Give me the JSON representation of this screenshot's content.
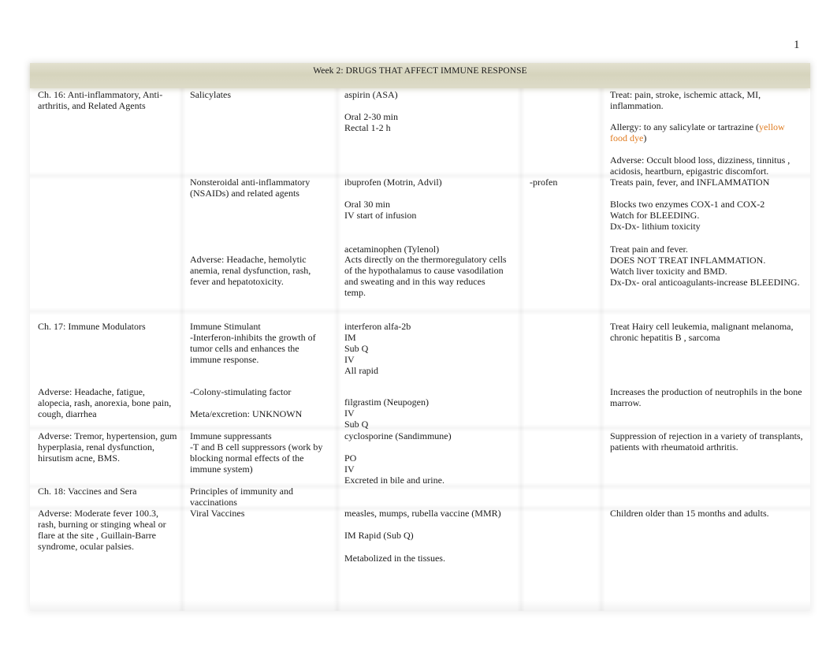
{
  "page_number": "1",
  "header": {
    "title": "Week 2:   DRUGS THAT AFFECT IMMUNE RESPONSE"
  },
  "rows": {
    "r1": {
      "chapter": "Ch. 16: Anti-inflammatory, Anti-\narthritis, and Related Agents",
      "class": "Salicylates",
      "drug_name": "aspirin (ASA)",
      "drug_routes": "Oral 2-30 min\nRectal 1-2 h",
      "stem": "",
      "uses": "Treat: pain, stroke, ischemic attack, MI,\ninflammation.",
      "allergy_prefix": "Allergy: to any salicylate or tartrazine (",
      "allergy_highlight": "yellow\nfood dye",
      "allergy_suffix": ")",
      "adverse": "Adverse: Occult blood loss, dizziness, tinnitus ,\nacidosis, heartburn, epigastric discomfort."
    },
    "r2": {
      "class": "Nonsteroidal anti-inflammatory\n(NSAIDs) and related agents",
      "class_adverse": "Adverse: Headache, hemolytic\nanemia, renal dysfunction, rash,\nfever and hepatotoxicity.",
      "drug_name": "ibuprofen (Motrin, Advil)",
      "drug_routes": "Oral 30 min\nIV start of infusion",
      "drug2_name": "acetaminophen (Tylenol)",
      "drug2_desc": "Acts directly on the thermoregulatory cells\nof the hypothalamus to cause vasodilation\nand sweating and in this way reduces\ntemp.",
      "stem": "-profen",
      "uses": "Treats pain, fever, and INFLAMMATION",
      "uses_detail": "Blocks two enzymes COX-1 and COX-2\nWatch for BLEEDING.\nDx-Dx- lithium toxicity",
      "uses2": "Treat pain and fever.\nDOES NOT TREAT INFLAMMATION.\nWatch liver toxicity and BMD.\nDx-Dx- oral anticoagulants-increase BLEEDING."
    },
    "r3": {
      "chapter": "Ch. 17: Immune Modulators",
      "chapter_adverse": "Adverse: Headache, fatigue,\nalopecia, rash, anorexia, bone pain,\ncough, diarrhea",
      "class": "Immune Stimulant\n-Interferon-inhibits the growth of\ntumor cells and enhances the\nimmune response.",
      "class2": "-Colony-stimulating factor",
      "class2_meta": "Meta/excretion: UNKNOWN",
      "drug_name": "interferon alfa-2b\nIM\nSub Q\nIV\nAll rapid",
      "drug2_name": "filgrastim (Neupogen)\nIV\nSub Q",
      "uses": "Treat Hairy cell leukemia, malignant melanoma,\nchronic hepatitis B  , sarcoma",
      "uses2": "Increases the production of neutrophils in the bone\nmarrow."
    },
    "r4": {
      "chapter_adverse": "Adverse: Tremor, hypertension, gum\nhyperplasia, renal dysfunction,\nhirsutism acne, BMS.",
      "class": "Immune suppressants\n-T and B cell suppressors (work by\nblocking normal effects of the\nimmune system)",
      "drug_name": "cyclosporine (Sandimmune)",
      "drug_routes": "PO\nIV\nExcreted in bile and urine.",
      "uses": "Suppression of rejection in a variety of transplants,\npatients with rheumatoid arthritis."
    },
    "r5": {
      "chapter": "Ch. 18: Vaccines and Sera",
      "class": "Principles of immunity and\nvaccinations"
    },
    "r6": {
      "chapter_adverse": "Adverse: Moderate fever 100.3,\nrash, burning or stinging wheal or\nflare at the site , Guillain-Barre\nsyndrome, ocular palsies.",
      "class": "Viral Vaccines",
      "drug_name": "measles, mumps, rubella vaccine (MMR)",
      "drug_route": "IM Rapid (Sub Q)",
      "drug_meta": "Metabolized in the tissues.",
      "uses": "Children older than 15 months and adults."
    }
  }
}
